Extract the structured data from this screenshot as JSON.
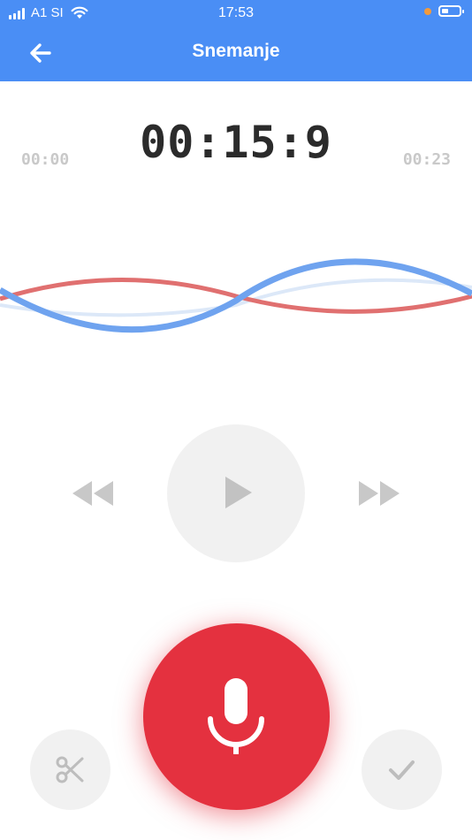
{
  "status_bar": {
    "carrier": "A1 SI",
    "time": "17:53",
    "signal_icon": "signal-bars-icon",
    "wifi_icon": "wifi-icon",
    "battery_icon": "battery-icon"
  },
  "header": {
    "title": "Snemanje",
    "back_icon": "arrow-left-icon",
    "color": "#4a8ef5"
  },
  "timer": {
    "current": "00:15:9",
    "start": "00:00",
    "end": "00:23"
  },
  "waveform": {
    "colors": [
      "#e07070",
      "#6fa3ef",
      "#dce8f8"
    ]
  },
  "controls": {
    "rewind_icon": "rewind-icon",
    "play_icon": "play-icon",
    "forward_icon": "fast-forward-icon",
    "record_icon": "microphone-icon",
    "record_color": "#e4313f",
    "trim_icon": "scissors-icon",
    "confirm_icon": "checkmark-icon"
  }
}
